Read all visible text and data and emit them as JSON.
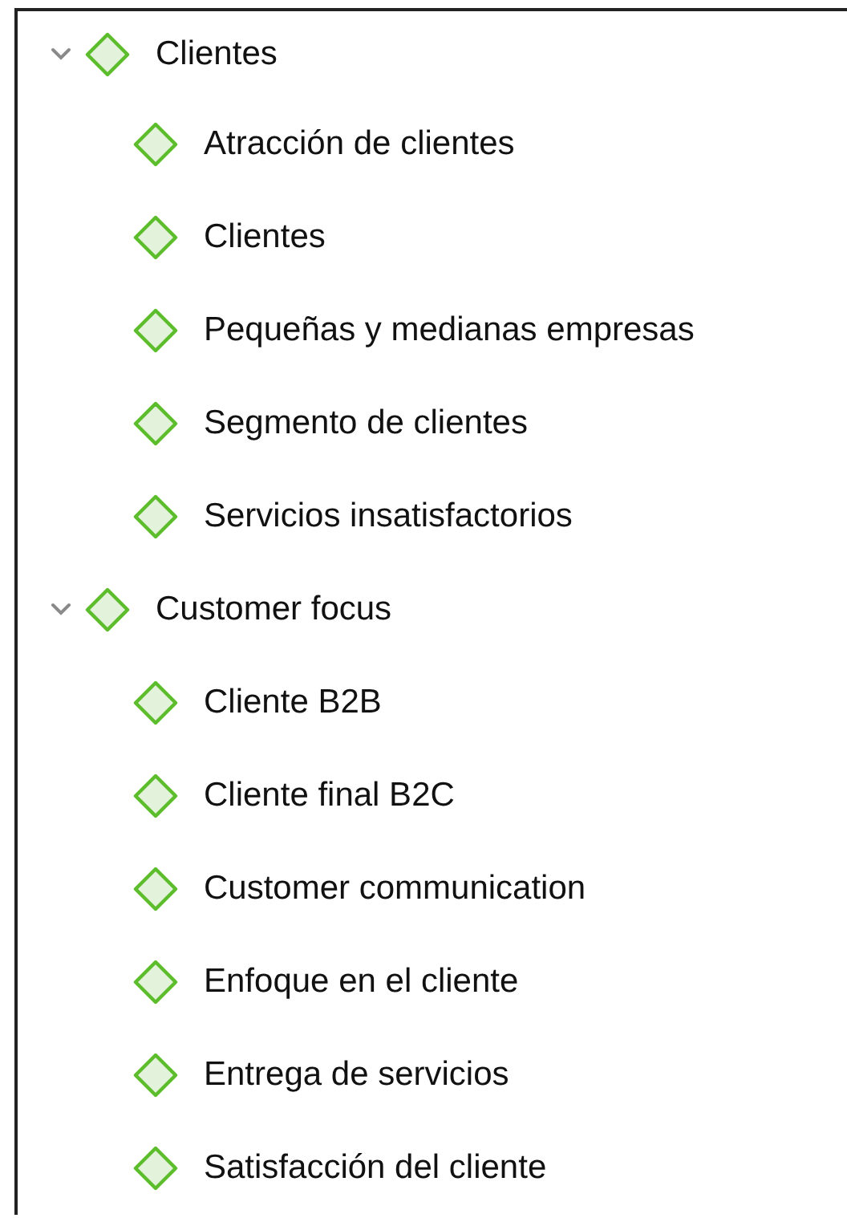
{
  "tree": [
    {
      "label": "Clientes",
      "expanded": true,
      "children": [
        {
          "label": "Atracción de clientes"
        },
        {
          "label": "Clientes"
        },
        {
          "label": "Pequeñas y medianas empresas"
        },
        {
          "label": "Segmento de clientes"
        },
        {
          "label": "Servicios insatisfactorios"
        }
      ]
    },
    {
      "label": "Customer focus",
      "expanded": true,
      "children": [
        {
          "label": "Cliente B2B"
        },
        {
          "label": "Cliente final B2C"
        },
        {
          "label": "Customer communication"
        },
        {
          "label": "Enfoque en el cliente"
        },
        {
          "label": "Entrega de servicios"
        },
        {
          "label": "Satisfacción del cliente"
        }
      ]
    }
  ]
}
